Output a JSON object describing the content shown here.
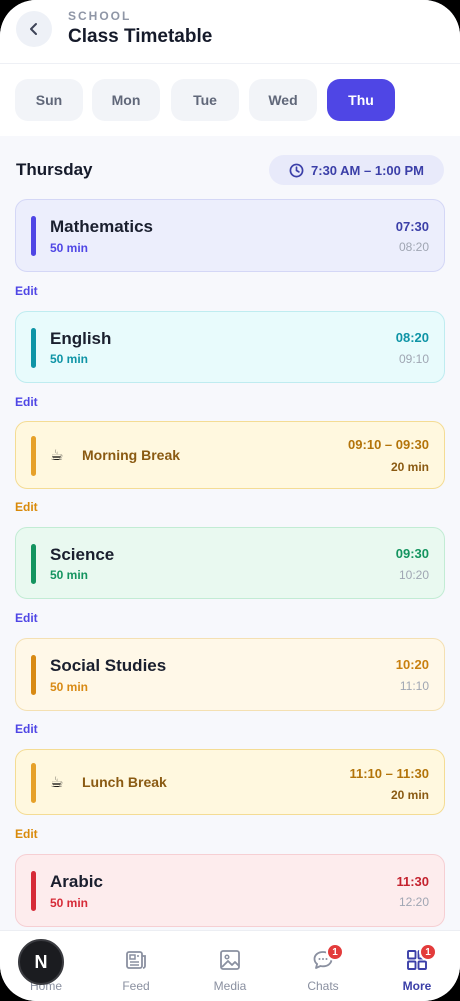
{
  "header": {
    "kicker": "SCHOOL",
    "title": "Class Timetable"
  },
  "days": [
    {
      "label": "Sun",
      "active": false
    },
    {
      "label": "Mon",
      "active": false
    },
    {
      "label": "Tue",
      "active": false
    },
    {
      "label": "Wed",
      "active": false
    },
    {
      "label": "Thu",
      "active": true
    }
  ],
  "section": {
    "title": "Thursday",
    "range": "7:30 AM – 1:00 PM"
  },
  "periods": [
    {
      "name": "Mathematics",
      "duration": "50 min",
      "start": "07:30",
      "end": "08:20",
      "edit": "Edit",
      "accent": "#4f46e5"
    },
    {
      "name": "English",
      "duration": "50 min",
      "start": "08:20",
      "end": "09:10",
      "edit": "Edit",
      "accent": "#0e94a6"
    },
    {
      "name": "Morning Break",
      "icon": "coffee-icon",
      "range": "09:10 – 09:30",
      "duration": "20 min",
      "edit": "Edit",
      "accent": "#e6a12a"
    },
    {
      "name": "Science",
      "duration": "50 min",
      "start": "09:30",
      "end": "10:20",
      "edit": "Edit",
      "accent": "#14945f"
    },
    {
      "name": "Social Studies",
      "duration": "50 min",
      "start": "10:20",
      "end": "11:10",
      "edit": "Edit",
      "accent": "#d88a14"
    },
    {
      "name": "Lunch Break",
      "icon": "coffee-icon",
      "range": "11:10 – 11:30",
      "duration": "20 min",
      "edit": "Edit",
      "accent": "#e6a12a"
    },
    {
      "name": "Arabic",
      "duration": "50 min",
      "start": "11:30",
      "end": "12:20",
      "accent": "#d62b38"
    }
  ],
  "nav": {
    "fab_letter": "N",
    "items": [
      {
        "label": "Home",
        "icon": "home-icon"
      },
      {
        "label": "Feed",
        "icon": "feed-icon"
      },
      {
        "label": "Media",
        "icon": "image-icon"
      },
      {
        "label": "Chats",
        "icon": "chat-icon",
        "badge": "1"
      },
      {
        "label": "More",
        "icon": "grid-icon",
        "badge": "1",
        "active": true
      }
    ]
  }
}
